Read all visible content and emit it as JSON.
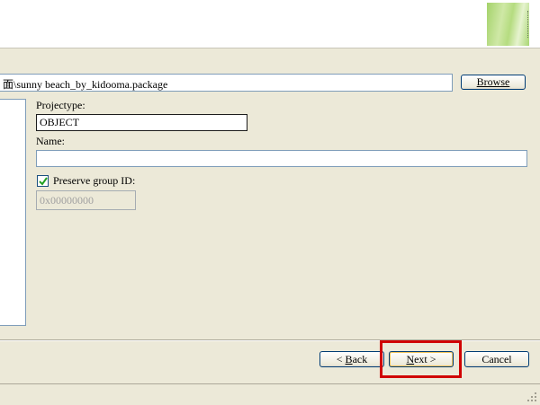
{
  "wizard": {
    "file_path": "面\\sunny beach_by_kidooma.package",
    "browse_label": "Browse",
    "projecttype_label": "Projectype:",
    "projecttype_value": "OBJECT",
    "name_label": "Name:",
    "name_value": "",
    "preserve_group_label": "Preserve group ID:",
    "preserve_group_checked": true,
    "group_id_placeholder": "0x00000000"
  },
  "footer": {
    "back_mnemonic": "B",
    "back_rest": "ack",
    "back_prefix": "< ",
    "next_mnemonic": "N",
    "next_rest": "ext >",
    "cancel_label": "Cancel"
  },
  "colors": {
    "highlight": "#d00000",
    "dialog_bg": "#ece9d8"
  }
}
